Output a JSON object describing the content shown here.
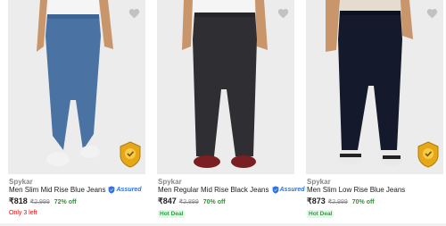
{
  "colors": {
    "assured_blue": "#2874f0",
    "discount_green": "#388e3c",
    "hot_deal_green": "#26a541",
    "stock_red": "#ff0000",
    "badge_gold": "#e6a817"
  },
  "icons": {
    "wishlist": "heart-icon",
    "assured": "assured-shield-icon",
    "badge": "brand-authorized-badge-icon"
  },
  "products": [
    {
      "brand": "Spykar",
      "title": "Men Slim Mid Rise Blue Jeans",
      "assured_label": "Assured",
      "price": "₹818",
      "mrp": "₹2,999",
      "discount": "72% off",
      "note": "Only 3 left",
      "jeans_color": "#4a73a4"
    },
    {
      "brand": "Spykar",
      "title": "Men Regular Mid Rise Black Jeans",
      "assured_label": "Assured",
      "price": "₹847",
      "mrp": "₹2,899",
      "discount": "70% off",
      "note": "Hot Deal",
      "jeans_color": "#2f2f33"
    },
    {
      "brand": "Spykar",
      "title": "Men Slim Low Rise Blue Jeans",
      "price": "₹873",
      "mrp": "₹2,999",
      "discount": "70% off",
      "note": "Hot Deal",
      "jeans_color": "#141a2b"
    }
  ]
}
